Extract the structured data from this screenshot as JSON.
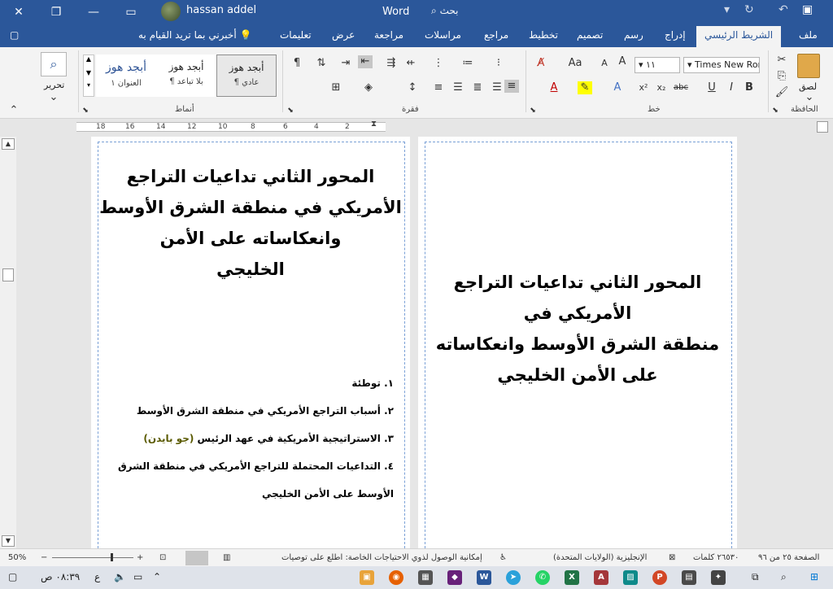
{
  "window": {
    "app_title": "Word",
    "search_placeholder": "بحث",
    "user_name": "hassan addel"
  },
  "tabs": [
    {
      "label": "ملف"
    },
    {
      "label": "الشريط الرئيسي"
    },
    {
      "label": "إدراج"
    },
    {
      "label": "رسم"
    },
    {
      "label": "تصميم"
    },
    {
      "label": "تخطيط"
    },
    {
      "label": "مراجع"
    },
    {
      "label": "مراسلات"
    },
    {
      "label": "مراجعة"
    },
    {
      "label": "عرض"
    },
    {
      "label": "تعليمات"
    },
    {
      "label": "أخبرني بما تريد القيام به"
    }
  ],
  "ribbon": {
    "clipboard": {
      "paste_label": "لصق",
      "group_label": "الحافظة"
    },
    "font": {
      "font_name": "Times New Rom",
      "font_size": "١١",
      "group_label": "خط",
      "grow": "A",
      "shrink": "A",
      "case": "Aa"
    },
    "paragraph": {
      "group_label": "فقرة"
    },
    "styles": {
      "group_label": "أنماط",
      "cards": [
        {
          "sample": "أبجد هوز",
          "name": "¶ عادي"
        },
        {
          "sample": "أبجد هوز",
          "name": "¶ بلا تباعد"
        },
        {
          "sample": "أبجد هوز",
          "name": "العنوان ١"
        }
      ]
    },
    "editing": {
      "label": "تحرير"
    }
  },
  "ruler": {
    "ticks": [
      "18",
      "16",
      "14",
      "12",
      "10",
      "8",
      "6",
      "4",
      "2"
    ]
  },
  "document": {
    "left_page": {
      "heading": [
        "المحور الثاني تداعيات التراجع",
        "الأمريكي في منطقة الشرق الأوسط",
        "وانعكاساته على الأمن",
        "الخليجي"
      ],
      "toc": [
        {
          "num": "١.",
          "text": "توطئة"
        },
        {
          "num": "٢.",
          "text": "أسباب التراجع الأمريكي في منطقة الشرق الأوسط"
        },
        {
          "num": "٣.",
          "text": "الاستراتيجية الأمريكية في عهد الرئيس",
          "highlight": "(جو بايدن)"
        },
        {
          "num": "٤.",
          "text": "التداعيات المحتملة للتراجع الأمريكي في منطقة الشرق"
        },
        {
          "num": "",
          "text": "الأوسط على الأمن الخليجي"
        }
      ]
    },
    "right_page": {
      "heading": [
        "المحور الثاني تداعيات التراجع",
        "الأمريكي في",
        "منطقة الشرق الأوسط وانعكاساته",
        "على الأمن الخليجي"
      ]
    }
  },
  "statusbar": {
    "page": "الصفحة ٢٥ من ٩٦",
    "words": "٢٦٥٣٠ كلمات",
    "language": "الإنجليزية (الولايات المتحدة)",
    "accessibility": "إمكانية الوصول لذوي الاحتياجات الخاصة: اطلع على توصيات",
    "zoom": "50%"
  },
  "taskbar": {
    "time": "٠٨:٣٩ ص",
    "lang": "ع"
  },
  "colors": {
    "titlebar": "#2b579a",
    "ribbon": "#f3f3f3",
    "margin_guides": "#7aa0d6"
  }
}
